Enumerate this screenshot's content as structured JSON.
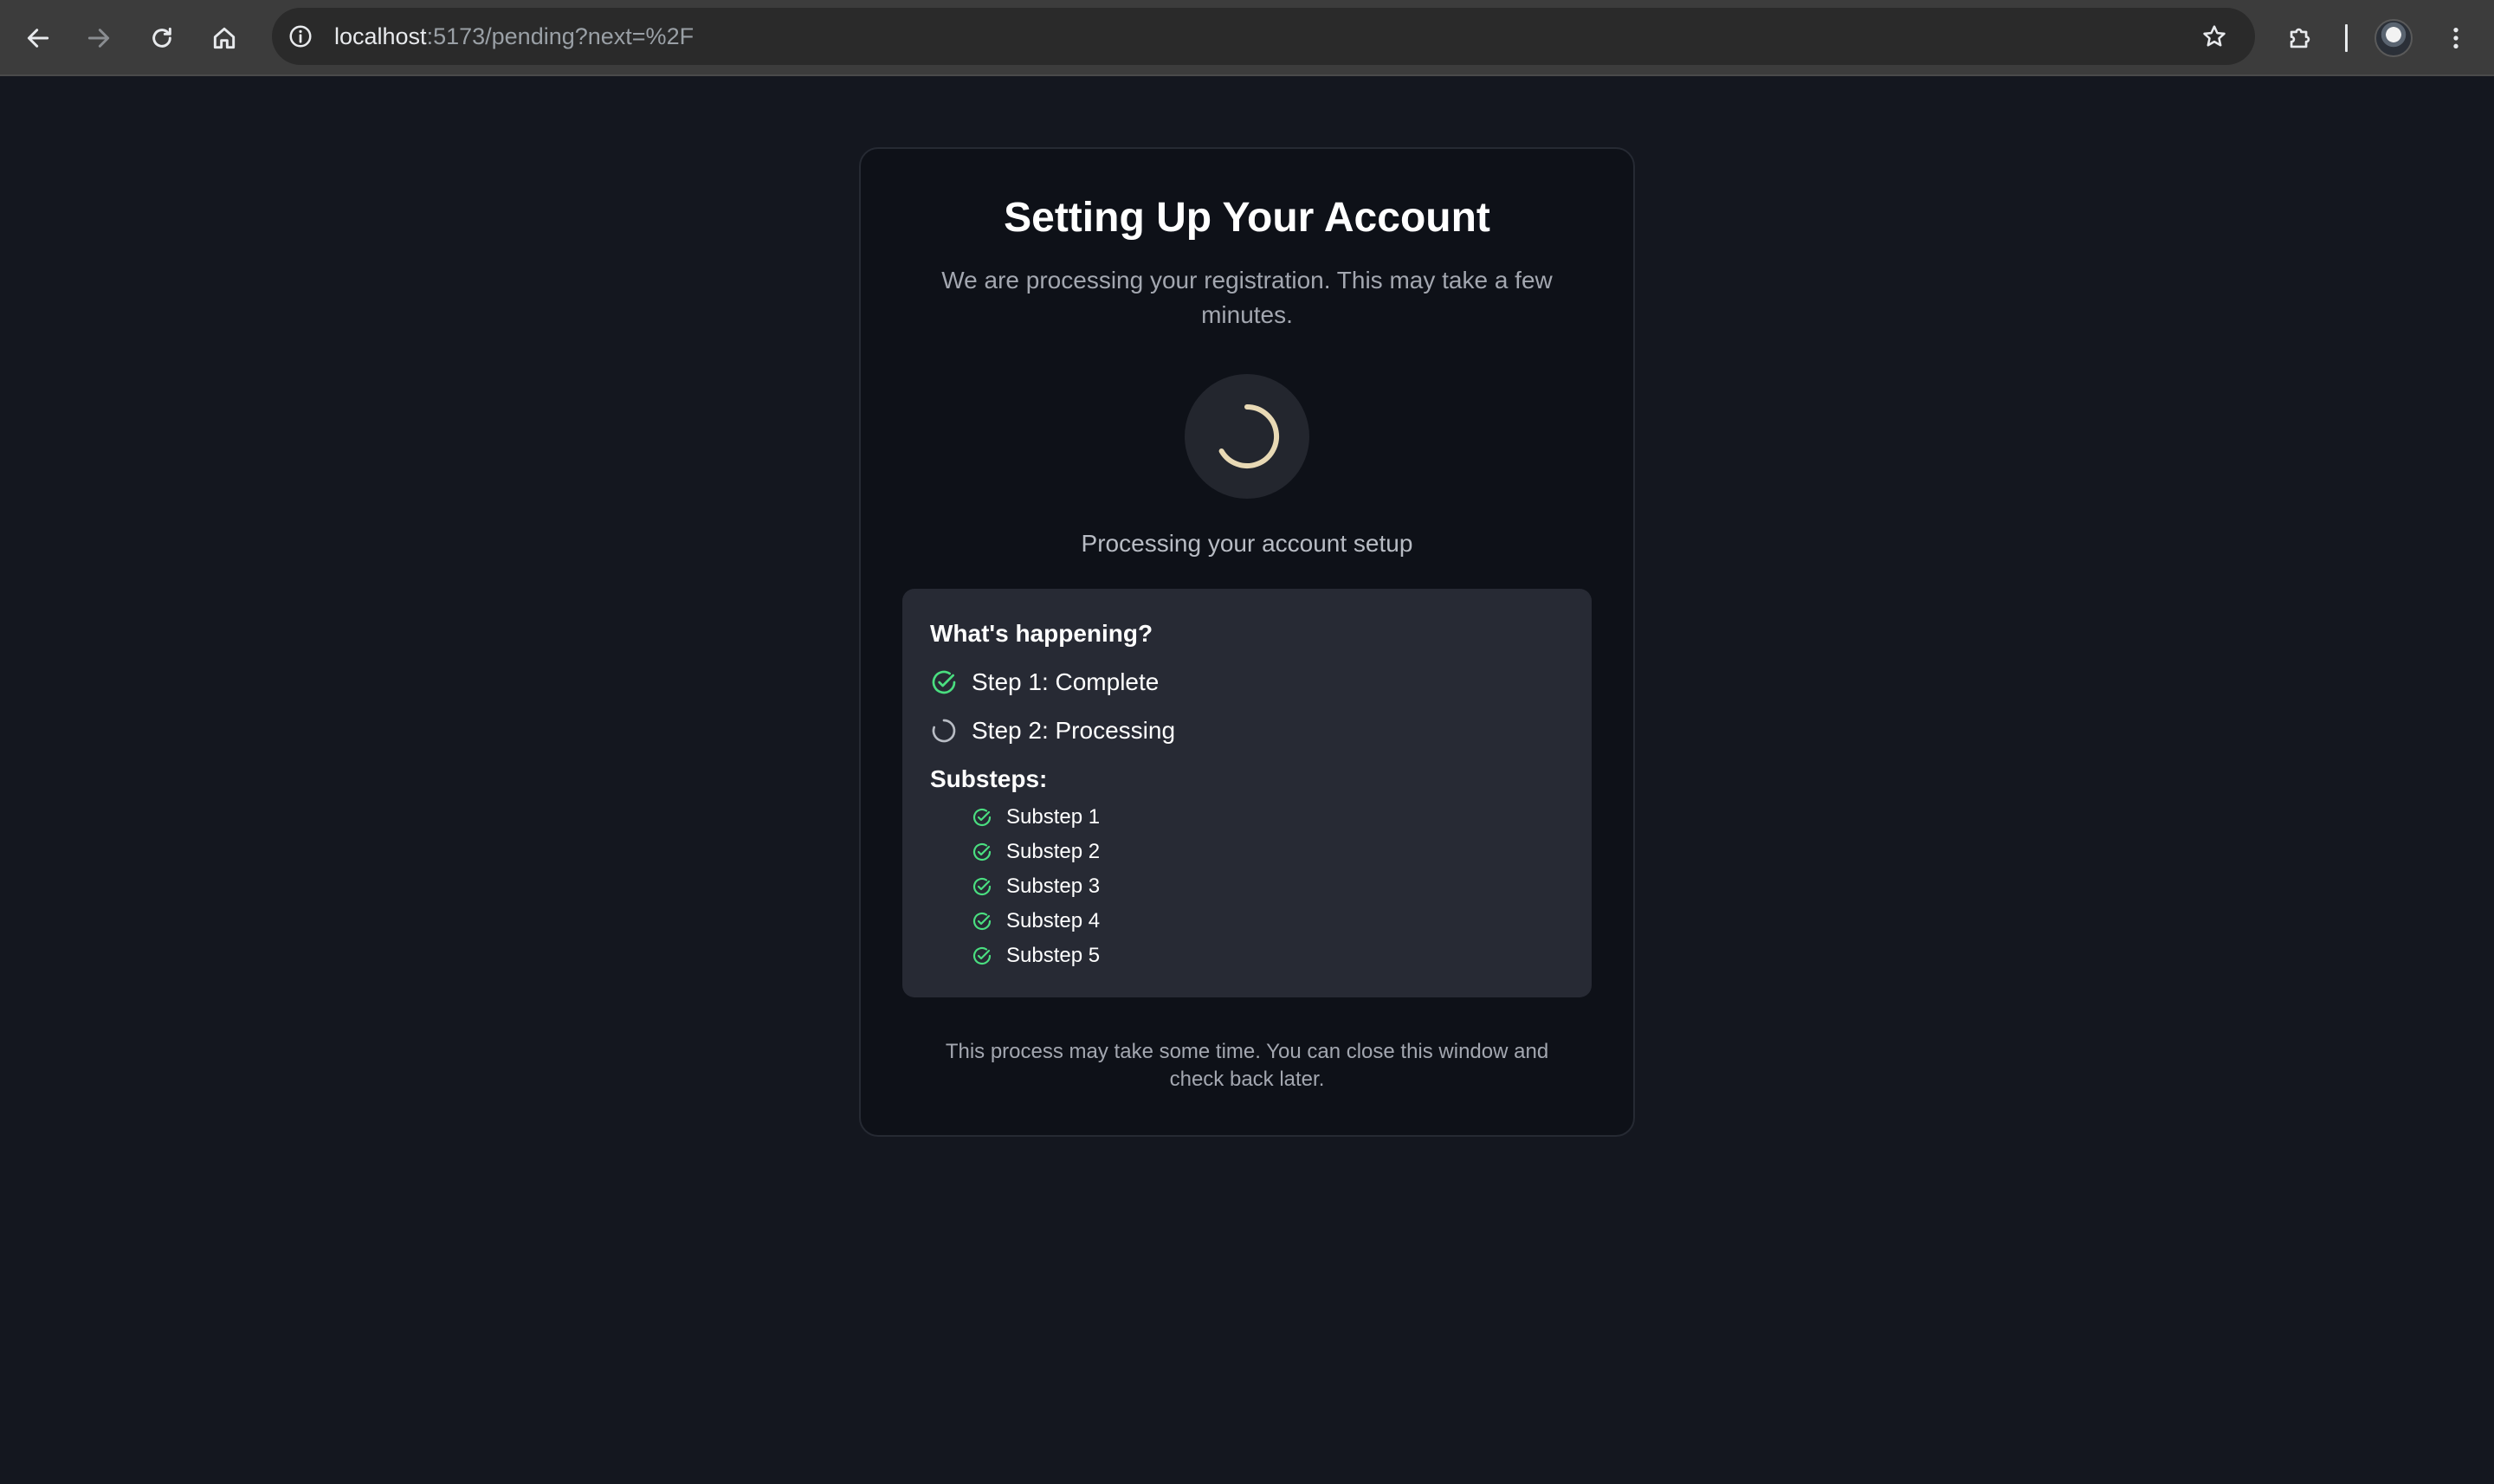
{
  "browser": {
    "url_host": "localhost",
    "url_rest": ":5173/pending?next=%2F",
    "icons": {
      "back": "arrow-left-icon",
      "forward": "arrow-right-icon",
      "reload": "reload-icon",
      "home": "home-icon",
      "site_info": "info-icon",
      "bookmark": "star-icon",
      "extensions": "puzzle-icon",
      "menu": "kebab-menu-icon"
    }
  },
  "card": {
    "title": "Setting Up Your Account",
    "subtitle": "We are processing your registration. This may take a few minutes.",
    "status_text": "Processing your account setup",
    "footnote": "This process may take some time. You can close this window and check back later."
  },
  "panel": {
    "heading": "What's happening?",
    "steps": [
      {
        "label": "Step 1: Complete",
        "state": "complete"
      },
      {
        "label": "Step 2: Processing",
        "state": "processing"
      }
    ],
    "substeps_heading": "Substeps:",
    "substeps": [
      {
        "label": "Substep 1",
        "state": "complete"
      },
      {
        "label": "Substep 2",
        "state": "complete"
      },
      {
        "label": "Substep 3",
        "state": "complete"
      },
      {
        "label": "Substep 4",
        "state": "complete"
      },
      {
        "label": "Substep 5",
        "state": "complete"
      }
    ]
  },
  "colors": {
    "page_bg": "#14171f",
    "card_bg": "#0e1118",
    "panel_bg": "#272a34",
    "success": "#4ade80",
    "spinner_accent": "#e8d9b5"
  }
}
